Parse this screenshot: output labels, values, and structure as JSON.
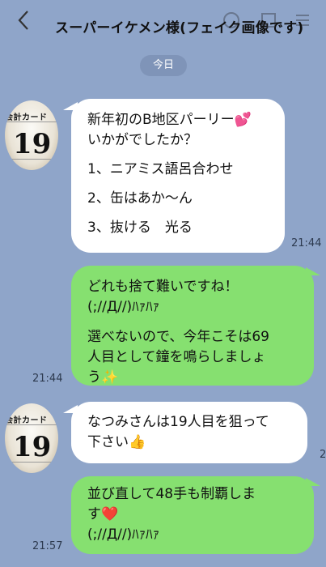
{
  "header": {
    "title": "スーパーイケメン様(フェイク画像です)",
    "back_icon": "back-chevron-icon",
    "icons": [
      "call-icon",
      "notes-icon",
      "menu-icon"
    ]
  },
  "date_label": "今日",
  "avatar": {
    "card_text": "会計カード",
    "card_number": "19"
  },
  "messages": [
    {
      "side": "in",
      "lines": [
        "新年初のB地区パーリー💕",
        "いかがでしたか？",
        "",
        "1、ニアミス語呂合わせ",
        "",
        "2、缶はあか〜ん",
        "",
        "3、抜ける　光る"
      ],
      "time": "21:44"
    },
    {
      "side": "out",
      "lines": [
        "どれも捨て難いですね！",
        "(;//Д//)ﾊｧﾊｧ",
        "",
        "選べないので、今年こそは69",
        "人目として鐘を鳴らしましょ",
        "う✨"
      ],
      "time": "21:44"
    },
    {
      "side": "in",
      "lines": [
        "なつみさんは19人目を狙って",
        "下さい👍"
      ],
      "time": "2"
    },
    {
      "side": "out",
      "lines": [
        "並び直して48手も制覇しま",
        "す❤️",
        "(;//Д//)ﾊｧﾊｧ"
      ],
      "time": "21:57"
    }
  ],
  "colors": {
    "background": "#8fa5c9",
    "outgoing": "#86e070",
    "incoming": "#ffffff"
  }
}
